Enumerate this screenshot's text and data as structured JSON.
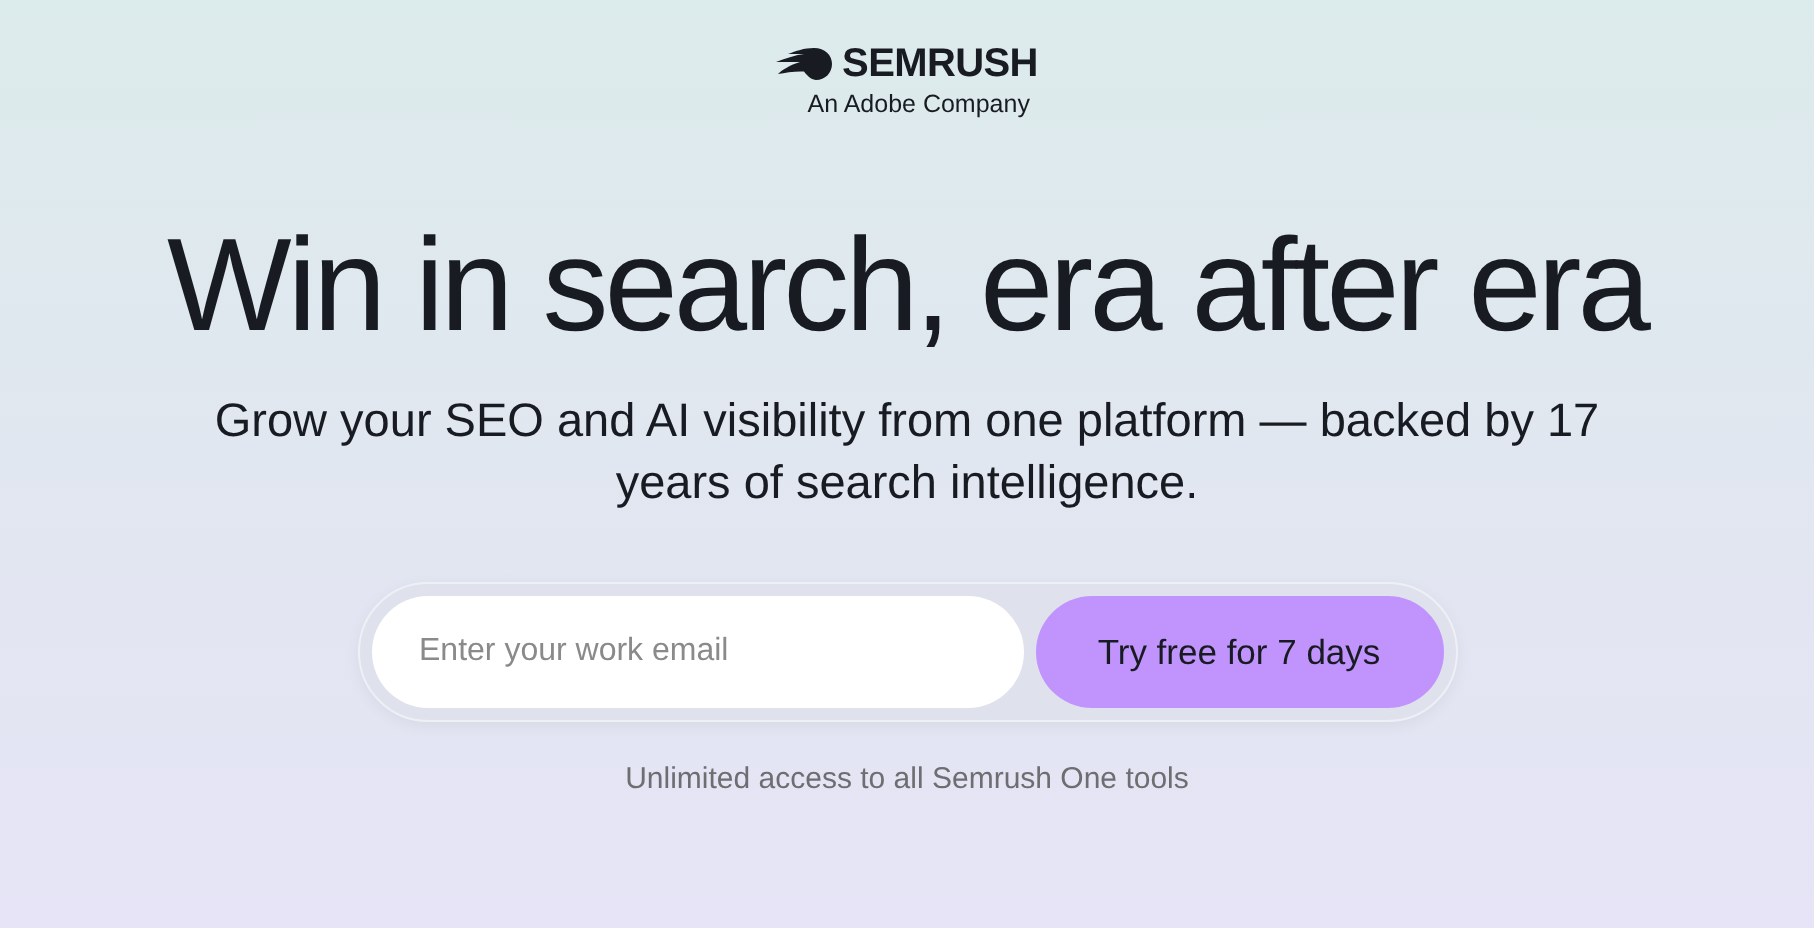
{
  "logo": {
    "name": "SEMRUSH",
    "tagline": "An Adobe Company"
  },
  "headline": "Win in search, era after era",
  "subheadline": "Grow your SEO and AI visibility from one platform — backed by 17 years of search intelligence.",
  "signup": {
    "placeholder": "Enter your work email",
    "button": "Try free for 7 days"
  },
  "note": "Unlimited access to all Semrush One tools"
}
